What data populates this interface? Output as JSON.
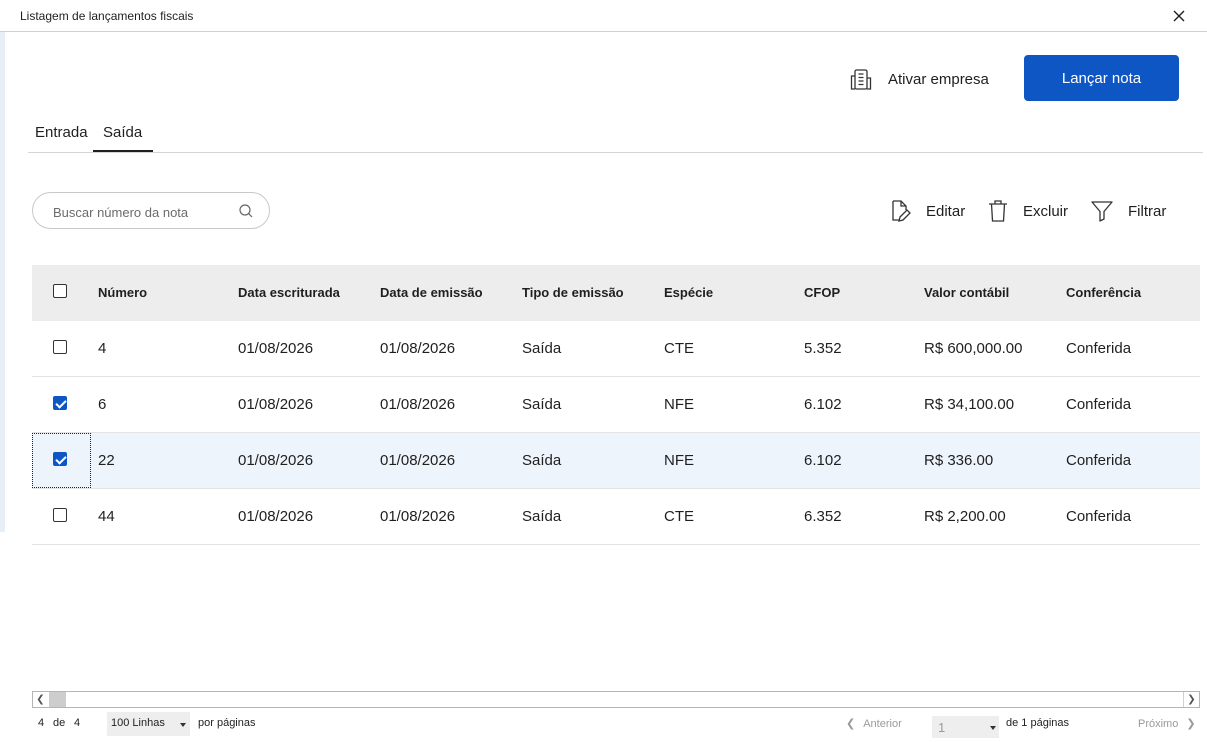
{
  "window": {
    "title": "Listagem de lançamentos fiscais"
  },
  "header": {
    "activate_label": "Ativar empresa",
    "launch_label": "Lançar nota",
    "accent_color": "#0f56c5"
  },
  "tabs": [
    {
      "label": "Entrada"
    },
    {
      "label": "Saída",
      "active": true
    }
  ],
  "search": {
    "placeholder": "Buscar número da nota",
    "value": ""
  },
  "toolbar": {
    "edit_label": "Editar",
    "delete_label": "Excluir",
    "filter_label": "Filtrar"
  },
  "table": {
    "columns": [
      "Número",
      "Data escriturada",
      "Data de emissão",
      "Tipo de emissão",
      "Espécie",
      "CFOP",
      "Valor contábil",
      "Conferência"
    ],
    "rows": [
      {
        "checked": false,
        "numero": "4",
        "data_escriturada": "01/08/2026",
        "data_emissao": "01/08/2026",
        "tipo": "Saída",
        "especie": "CTE",
        "cfop": "5.352",
        "valor": "R$ 600,000.00",
        "conferencia": "Conferida"
      },
      {
        "checked": true,
        "numero": "6",
        "data_escriturada": "01/08/2026",
        "data_emissao": "01/08/2026",
        "tipo": "Saída",
        "especie": "NFE",
        "cfop": "6.102",
        "valor": "R$ 34,100.00",
        "conferencia": "Conferida"
      },
      {
        "checked": true,
        "numero": "22",
        "data_escriturada": "01/08/2026",
        "data_emissao": "01/08/2026",
        "tipo": "Saída",
        "especie": "NFE",
        "cfop": "6.102",
        "valor": "R$ 336.00",
        "conferencia": "Conferida"
      },
      {
        "checked": false,
        "numero": "44",
        "data_escriturada": "01/08/2026",
        "data_emissao": "01/08/2026",
        "tipo": "Saída",
        "especie": "CTE",
        "cfop": "6.352",
        "valor": "R$ 2,200.00",
        "conferencia": "Conferida"
      }
    ]
  },
  "footer": {
    "count": "4",
    "of": "de",
    "total": "4",
    "rows_per_page": "100 Linhas",
    "per_page_label": "por páginas",
    "prev_label": "Anterior",
    "current_page": "1",
    "pages_label": "de 1 páginas",
    "next_label": "Próximo"
  }
}
